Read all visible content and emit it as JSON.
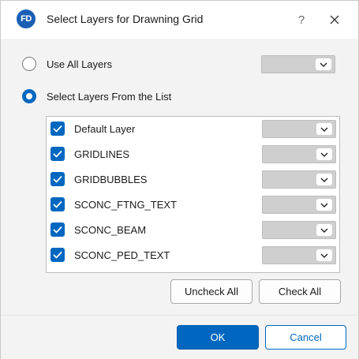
{
  "window": {
    "app_icon_text": "FD",
    "title": "Select Layers for Drawning Grid",
    "help_label": "?"
  },
  "options": {
    "use_all": {
      "label": "Use All Layers",
      "selected": false
    },
    "select_list": {
      "label": "Select Layers From the List",
      "selected": true
    }
  },
  "layers": [
    {
      "name": "Default Layer",
      "checked": true,
      "value": ""
    },
    {
      "name": "GRIDLINES",
      "checked": true,
      "value": ""
    },
    {
      "name": "GRIDBUBBLES",
      "checked": true,
      "value": ""
    },
    {
      "name": "SCONC_FTNG_TEXT",
      "checked": true,
      "value": ""
    },
    {
      "name": "SCONC_BEAM",
      "checked": true,
      "value": ""
    },
    {
      "name": "SCONC_PED_TEXT",
      "checked": true,
      "value": ""
    }
  ],
  "buttons": {
    "uncheck_all": "Uncheck All",
    "check_all": "Check All",
    "ok": "OK",
    "cancel": "Cancel"
  },
  "colors": {
    "accent": "#0067c0",
    "app_icon": "#1b5fb4",
    "combo_disabled": "#cfcfcf",
    "dialog_bg": "#f3f3f3"
  },
  "icons": {
    "app": "fd-app-icon",
    "close": "close-icon",
    "help": "help-icon",
    "dropdown": "chevron-down-icon",
    "check": "checkmark-icon"
  }
}
